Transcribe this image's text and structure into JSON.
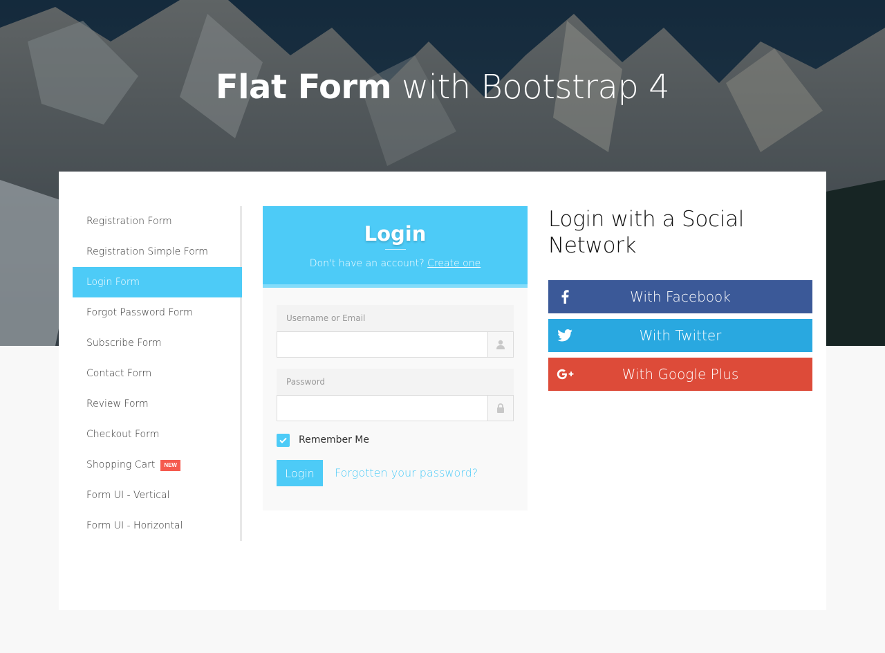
{
  "header": {
    "title_bold": "Flat Form",
    "title_rest": " with Bootstrap 4"
  },
  "sidebar": {
    "items": [
      {
        "label": "Registration Form"
      },
      {
        "label": "Registration Simple Form"
      },
      {
        "label": "Login Form",
        "active": true
      },
      {
        "label": "Forgot Password Form"
      },
      {
        "label": "Subscribe Form"
      },
      {
        "label": "Contact Form"
      },
      {
        "label": "Review Form"
      },
      {
        "label": "Checkout Form"
      },
      {
        "label": "Shopping Cart",
        "badge": "NEW"
      },
      {
        "label": "Form UI - Vertical"
      },
      {
        "label": "Form UI - Horizontal"
      }
    ]
  },
  "login": {
    "title": "Login",
    "subtitle_text": "Don't have an account?",
    "subtitle_link": "Create one",
    "username_label": "Username or Email",
    "username_value": "",
    "username_icon": "user-icon",
    "password_label": "Password",
    "password_value": "",
    "password_icon": "lock-icon",
    "remember_label": "Remember Me",
    "remember_checked": true,
    "button_label": "Login",
    "forgot_link": "Forgotten your password?"
  },
  "social": {
    "title": "Login with a Social Network",
    "buttons": [
      {
        "label": "With Facebook",
        "icon": "facebook-icon",
        "color": "#3b5998"
      },
      {
        "label": "With Twitter",
        "icon": "twitter-icon",
        "color": "#29a8e0"
      },
      {
        "label": "With Google Plus",
        "icon": "google-plus-icon",
        "color": "#dd4b39"
      }
    ]
  },
  "colors": {
    "accent": "#4dcbf7",
    "badge": "#f55a4e"
  }
}
